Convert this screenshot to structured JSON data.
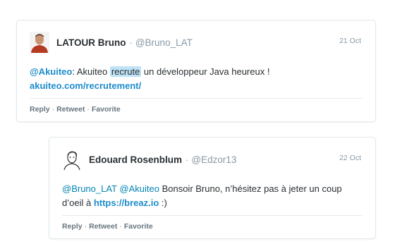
{
  "tweets": [
    {
      "author": "LATOUR Bruno",
      "handle": "@Bruno_LAT",
      "date": "21 Oct",
      "mention": "@Akuiteo",
      "text_pre": ": Akuiteo ",
      "highlight": "recrute",
      "text_post": " un développeur Java heureux !",
      "link": "akuiteo.com/recrutement/",
      "actions": {
        "reply": "Reply",
        "retweet": "Retweet",
        "favorite": "Favorite"
      }
    },
    {
      "author": "Edouard Rosenblum",
      "handle": "@Edzor13",
      "date": "22 Oct",
      "mention1": "@Bruno_LAT",
      "mention2": "@Akuiteo",
      "text_1": " Bonsoir Bruno, n’hésitez pas à jeter un coup",
      "text_2": "d’oeil à ",
      "link": "https://breaz.io",
      "text_3": " :)",
      "actions": {
        "reply": "Reply",
        "retweet": "Retweet",
        "favorite": "Favorite"
      }
    }
  ],
  "separator": "·"
}
